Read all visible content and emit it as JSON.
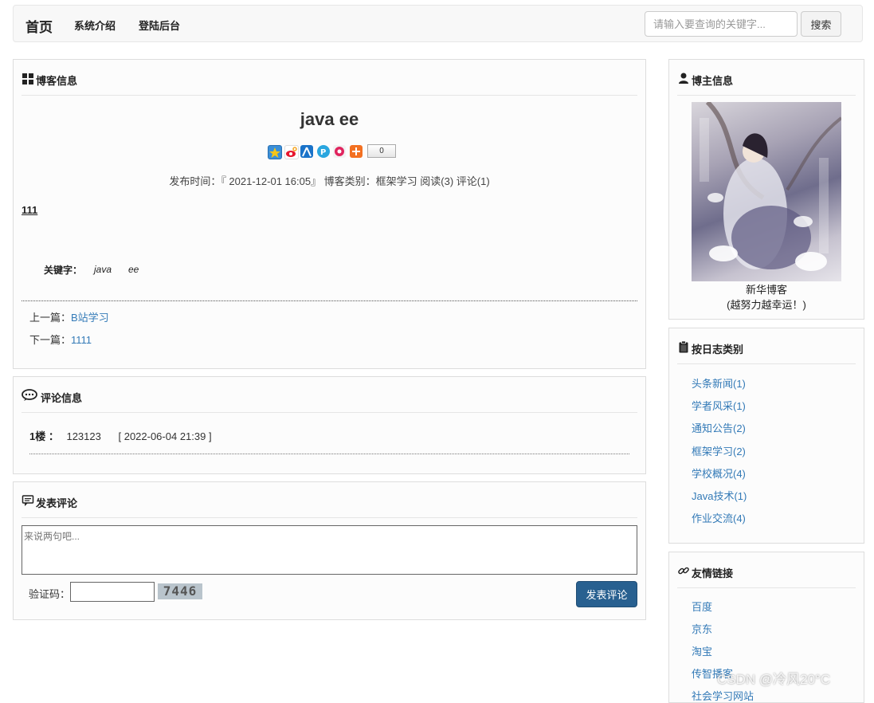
{
  "nav": {
    "brand": "首页",
    "items": [
      "系统介绍",
      "登陆后台"
    ],
    "search_placeholder": "请输入要查询的关键字...",
    "search_button": "搜索"
  },
  "blog": {
    "panel_title": "博客信息",
    "title": "java ee",
    "share_count": "0",
    "meta": "发布时间：『 2021-12-01 16:05』  博客类别：框架学习  阅读(3) 评论(1)",
    "content": "111",
    "keywords_label": "关键字：",
    "keywords": [
      "java",
      "ee"
    ],
    "prev_label": "上一篇：",
    "prev_link": "B站学习",
    "next_label": "下一篇：",
    "next_link": "1111"
  },
  "comments": {
    "panel_title": "评论信息",
    "items": [
      {
        "floor": "1楼 ：",
        "text": "123123",
        "time": "[ 2022-06-04 21:39 ]"
      }
    ]
  },
  "post_comment": {
    "panel_title": "发表评论",
    "placeholder": "来说两句吧...",
    "captcha_label": "验证码：",
    "captcha_code": "7446",
    "submit": "发表评论"
  },
  "blogger": {
    "panel_title": "博主信息",
    "name": "新华博客",
    "motto": "(越努力越幸运！)"
  },
  "categories": {
    "panel_title": "按日志类别",
    "items": [
      "头条新闻(1)",
      "学者风采(1)",
      "通知公告(2)",
      "框架学习(2)",
      "学校概况(4)",
      "Java技术(1)",
      "作业交流(4)"
    ]
  },
  "links": {
    "panel_title": "友情链接",
    "items": [
      "百度",
      "京东",
      "淘宝",
      "传智播客",
      "社会学习网站"
    ]
  },
  "watermark": "CSDN @冷风20°C"
}
